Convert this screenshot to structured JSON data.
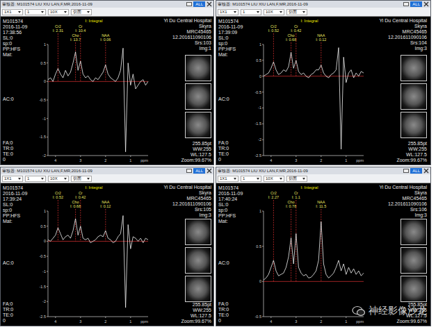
{
  "panels": [
    {
      "title": "审核器: M101574 LIU XIU LAN,F,MR,2016-11-09",
      "dropdowns": [
        "1X1",
        "1",
        "10X",
        "切面"
      ],
      "all_button": "ALL",
      "left_top": [
        "M101574",
        "2016-11-09",
        "17:38:56",
        "SL:0",
        "sp:0",
        "PP:HFS",
        "Mat:"
      ],
      "left_mid": [
        "AC:0"
      ],
      "left_bottom": [
        "FA:0",
        "TR:0",
        "TE:0",
        "0"
      ],
      "right_top": [
        "Yi Du Central Hospital",
        "Skyra",
        "MRC45465",
        "12.201611090106",
        "Srs:103",
        "Img:1"
      ],
      "right_bottom": [
        "255.85pt",
        "WW:255",
        "WL:127.5",
        "Zoom:99.67%"
      ],
      "chart": {
        "title": "I: Integral",
        "y_ticks": [
          "1",
          "0.5",
          "0",
          "-0.5",
          "-1",
          "-1.5",
          "-2"
        ],
        "x_ticks": [
          "4",
          "3",
          "2",
          "1"
        ],
        "x_unit": "ppm",
        "ppm_start": 4.3,
        "ppm_end": 0.3,
        "values": [
          0.05,
          0.1,
          0.0,
          0.2,
          0.35,
          0.2,
          0.1,
          0.3,
          0.15,
          0.25,
          0.5,
          0.8,
          0.3,
          0.55,
          0.2,
          0.1,
          0.15,
          0.05,
          0.0,
          0.1,
          0.05,
          0.15,
          0.25,
          0.45,
          0.2,
          0.1,
          0.05,
          0.0,
          0.1,
          0.3,
          0.9,
          -1.9,
          0.5,
          -0.1,
          0.2,
          -0.2,
          -0.1,
          0.0,
          0.05,
          -0.1,
          0.0
        ],
        "peaks": [
          {
            "name": "Cr2",
            "integral": "I: 2.31",
            "ppm": 3.9
          },
          {
            "name": "Cho",
            "integral": "I: 13.7",
            "ppm": 3.2
          },
          {
            "name": "Cr",
            "integral": "I: 10.4",
            "ppm": 3.0
          },
          {
            "name": "NAA",
            "integral": "I: 0.06",
            "ppm": 2.0
          }
        ]
      }
    },
    {
      "title": "审核器: M101574 LIU XIU LAN,F,MR,2016-11-09",
      "dropdowns": [
        "1X1",
        "1",
        "10X",
        "切面"
      ],
      "all_button": "ALL",
      "left_top": [
        "M101574",
        "2016-11-09",
        "17:39:09",
        "SL:0",
        "sp:0",
        "PP:HFS",
        "Mat:"
      ],
      "left_mid": [
        "AC:0"
      ],
      "left_bottom": [
        "FA:0",
        "TR:0",
        "TE:0",
        "0"
      ],
      "right_top": [
        "Yi Du Central Hospital",
        "Skyra",
        "MRC45465",
        "12.201611090106",
        "Srs:104",
        "Img:3"
      ],
      "right_bottom": [
        "255.85pt",
        "WW:255",
        "WL:127.5",
        "Zoom:99.67%"
      ],
      "chart": {
        "title": "I: Integral",
        "y_ticks": [
          "1",
          "0.5",
          "0",
          "-0.5",
          "-1",
          "-1.5",
          "-2",
          "-2.5"
        ],
        "x_ticks": [
          "4",
          "3",
          "2",
          "1"
        ],
        "x_unit": "ppm",
        "ppm_start": 4.3,
        "ppm_end": 0.3,
        "values": [
          0.0,
          0.05,
          0.1,
          0.25,
          0.45,
          0.2,
          0.05,
          0.1,
          0.2,
          0.15,
          0.3,
          0.75,
          0.25,
          0.5,
          0.15,
          0.05,
          0.1,
          0.0,
          -0.05,
          0.05,
          0.1,
          0.2,
          0.2,
          0.35,
          0.1,
          0.0,
          -0.05,
          0.05,
          0.1,
          0.2,
          0.9,
          -2.3,
          0.6,
          -0.2,
          0.1,
          0.2,
          -0.05,
          0.1,
          0.0,
          0.15,
          0.1
        ],
        "peaks": [
          {
            "name": "Cr2",
            "integral": "I: 0.52",
            "ppm": 3.9
          },
          {
            "name": "Cho",
            "integral": "I: 0.68",
            "ppm": 3.2
          },
          {
            "name": "Cr",
            "integral": "I: 0.42",
            "ppm": 3.0
          },
          {
            "name": "NAA",
            "integral": "I: 0.12",
            "ppm": 2.0
          }
        ]
      }
    },
    {
      "title": "审核器: M101574 LIU XIU LAN,F,MR,2016-11-09",
      "dropdowns": [
        "1X1",
        "1",
        "10X",
        "切面"
      ],
      "all_button": "ALL",
      "left_top": [
        "M101574",
        "2016-11-09",
        "17:39:24",
        "SL:0",
        "sp:0",
        "PP:HFS",
        "Mat:"
      ],
      "left_mid": [
        "AC:0"
      ],
      "left_bottom": [
        "FA:0",
        "TR:0",
        "TE:0",
        "0"
      ],
      "right_top": [
        "Yi Du Central Hospital",
        "Skyra",
        "MRC45465",
        "12.201611090106",
        "Srs:105",
        "Img:3"
      ],
      "right_bottom": [
        "255.85pt",
        "WW:255",
        "WL:127.5",
        "Zoom:99.67%"
      ],
      "chart": {
        "title": "I: Integral",
        "y_ticks": [
          "1",
          "0.5",
          "0",
          "-0.5",
          "-1",
          "-1.5",
          "-2",
          "-2.5"
        ],
        "x_ticks": [
          "4",
          "3",
          "2",
          "1"
        ],
        "x_unit": "ppm",
        "ppm_start": 4.3,
        "ppm_end": 0.3,
        "values": [
          0.05,
          0.0,
          0.1,
          0.2,
          0.45,
          0.25,
          0.05,
          0.15,
          0.2,
          0.1,
          0.35,
          0.75,
          0.2,
          0.5,
          0.1,
          0.05,
          0.1,
          -0.05,
          0.0,
          0.05,
          0.15,
          0.2,
          0.15,
          0.35,
          0.1,
          0.05,
          -0.05,
          0.0,
          0.15,
          0.25,
          0.85,
          -2.2,
          0.55,
          -0.25,
          0.15,
          0.1,
          0.0,
          0.1,
          -0.05,
          0.1,
          0.05
        ],
        "peaks": [
          {
            "name": "Cr2",
            "integral": "I: 0.52",
            "ppm": 3.9
          },
          {
            "name": "Cho",
            "integral": "I: 0.68",
            "ppm": 3.2
          },
          {
            "name": "Cr",
            "integral": "I: 0.42",
            "ppm": 3.0
          },
          {
            "name": "NAA",
            "integral": "I: 0.12",
            "ppm": 2.0
          }
        ]
      }
    },
    {
      "title": "审核器: M101574 LIU XIU LAN,F,MR,2016-11-09",
      "dropdowns": [
        "1X1",
        "1",
        "10X",
        "切面"
      ],
      "all_button": "ALL",
      "left_top": [
        "M101574",
        "2016-11-09",
        "17:40:24",
        "SL:0",
        "sp:0",
        "PP:HFS",
        "Mat:"
      ],
      "left_mid": [
        "AC:0"
      ],
      "left_bottom": [
        "FA:0",
        "TR:0",
        "TE:0",
        "0"
      ],
      "right_top": [
        "Yi Du Central Hospital",
        "Skyra",
        "MRC45465",
        "12.201611090106",
        "Srs:106",
        "Img:3"
      ],
      "right_bottom": [
        "255.85pt",
        "WW:255",
        "WL:127.5",
        "Zoom:99.67%"
      ],
      "chart": {
        "title": "I: Integral",
        "y_ticks": [
          "1",
          "0.5",
          "0",
          "-0.5"
        ],
        "x_ticks": [
          "4",
          "3",
          "2",
          "1"
        ],
        "x_unit": "ppm",
        "ppm_start": 4.3,
        "ppm_end": 0.3,
        "values": [
          0.02,
          0.05,
          0.1,
          0.2,
          0.3,
          0.15,
          0.08,
          0.1,
          0.12,
          0.2,
          0.35,
          0.62,
          0.25,
          0.68,
          0.2,
          0.12,
          0.08,
          0.1,
          0.05,
          0.06,
          0.1,
          0.15,
          0.3,
          0.85,
          0.25,
          0.1,
          0.05,
          0.08,
          0.12,
          0.2,
          0.3,
          0.15,
          0.25,
          0.1,
          0.2,
          0.12,
          0.18,
          0.1,
          0.15,
          0.08,
          0.12
        ],
        "peaks": [
          {
            "name": "Cr2",
            "integral": "I: 2.27",
            "ppm": 3.9
          },
          {
            "name": "Cho",
            "integral": "I: 0.78",
            "ppm": 3.2
          },
          {
            "name": "Cr",
            "integral": "I: 1.1",
            "ppm": 3.0
          },
          {
            "name": "NAA",
            "integral": "I: 11.5",
            "ppm": 2.0
          }
        ]
      }
    }
  ],
  "watermark": "神经影像沙龙"
}
